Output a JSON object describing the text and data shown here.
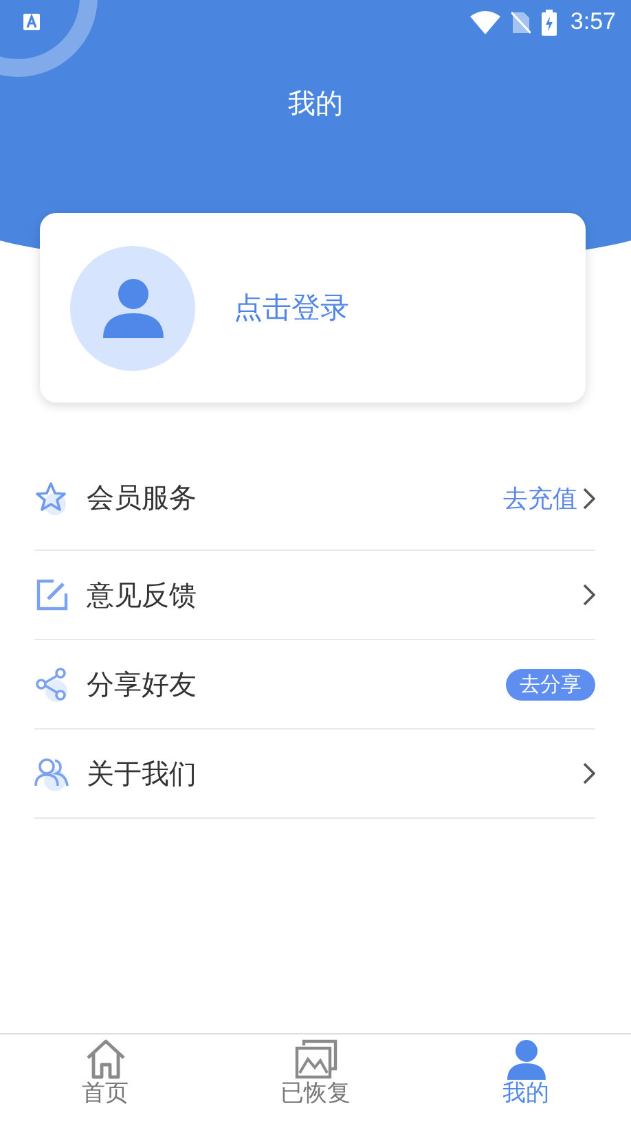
{
  "status_bar": {
    "time": "3:57"
  },
  "header": {
    "title": "我的"
  },
  "profile": {
    "login_label": "点击登录"
  },
  "menu": [
    {
      "label": "会员服务",
      "kind": "link",
      "action": "去充值"
    },
    {
      "label": "意见反馈",
      "kind": "chevron"
    },
    {
      "label": "分享好友",
      "kind": "pill",
      "action": "去分享"
    },
    {
      "label": "关于我们",
      "kind": "chevron"
    }
  ],
  "tabs": [
    {
      "label": "首页",
      "selected": false
    },
    {
      "label": "已恢复",
      "selected": false
    },
    {
      "label": "我的",
      "selected": true
    }
  ]
}
